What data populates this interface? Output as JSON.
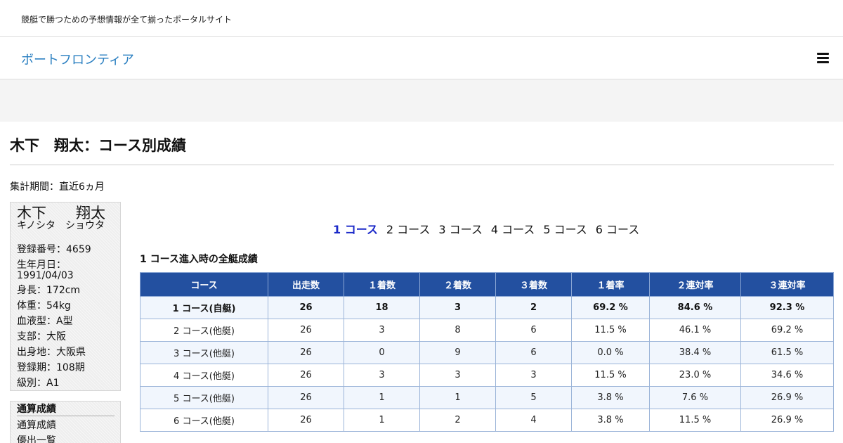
{
  "header": {
    "tagline": "競艇で勝つための予想情報が全て揃ったポータルサイト",
    "site_title": "ボートフロンティア",
    "menu_icon": "hamburger-menu-icon"
  },
  "page": {
    "title": "木下　翔太：コース別成績",
    "period": "集計期間：直近6ヵ月"
  },
  "profile": {
    "name": "木下　　翔太",
    "kana": "キノシタ　ショウタ",
    "fields": [
      "登録番号：4659",
      "生年月日：",
      "1991/04/03",
      "身長：172cm",
      "体重：54kg",
      "血液型：A型",
      "支部：大阪",
      "出身地：大阪県",
      "登録期：108期",
      "級別：A1"
    ]
  },
  "stats_menu": {
    "heading": "通算成績",
    "links": [
      "通算成績",
      "優出一覧"
    ]
  },
  "course_tabs": [
    {
      "label": "1 コース",
      "active": true
    },
    {
      "label": "2 コース",
      "active": false
    },
    {
      "label": "3 コース",
      "active": false
    },
    {
      "label": "4 コース",
      "active": false
    },
    {
      "label": "5 コース",
      "active": false
    },
    {
      "label": "6 コース",
      "active": false
    }
  ],
  "section_heading": "1 コース進入時の全艇成績",
  "table": {
    "headers": [
      "コース",
      "出走数",
      "１着数",
      "２着数",
      "３着数",
      "１着率",
      "２連対率",
      "３連対率"
    ],
    "rows": [
      [
        "1 コース(自艇)",
        "26",
        "18",
        "3",
        "2",
        "69.2 %",
        "84.6 %",
        "92.3 %"
      ],
      [
        "2 コース(他艇)",
        "26",
        "3",
        "8",
        "6",
        "11.5 %",
        "46.1 %",
        "69.2 %"
      ],
      [
        "3 コース(他艇)",
        "26",
        "0",
        "9",
        "6",
        "0.0 %",
        "38.4 %",
        "61.5 %"
      ],
      [
        "4 コース(他艇)",
        "26",
        "3",
        "3",
        "3",
        "11.5 %",
        "23.0 %",
        "34.6 %"
      ],
      [
        "5 コース(他艇)",
        "26",
        "1",
        "1",
        "5",
        "3.8 %",
        "7.6 %",
        "26.9 %"
      ],
      [
        "6 コース(他艇)",
        "26",
        "1",
        "2",
        "4",
        "3.8 %",
        "11.5 %",
        "26.9 %"
      ]
    ]
  },
  "colors": {
    "accent": "#2a7fc1",
    "active_tab": "#1a28c8",
    "table_header": "#2350a0"
  }
}
